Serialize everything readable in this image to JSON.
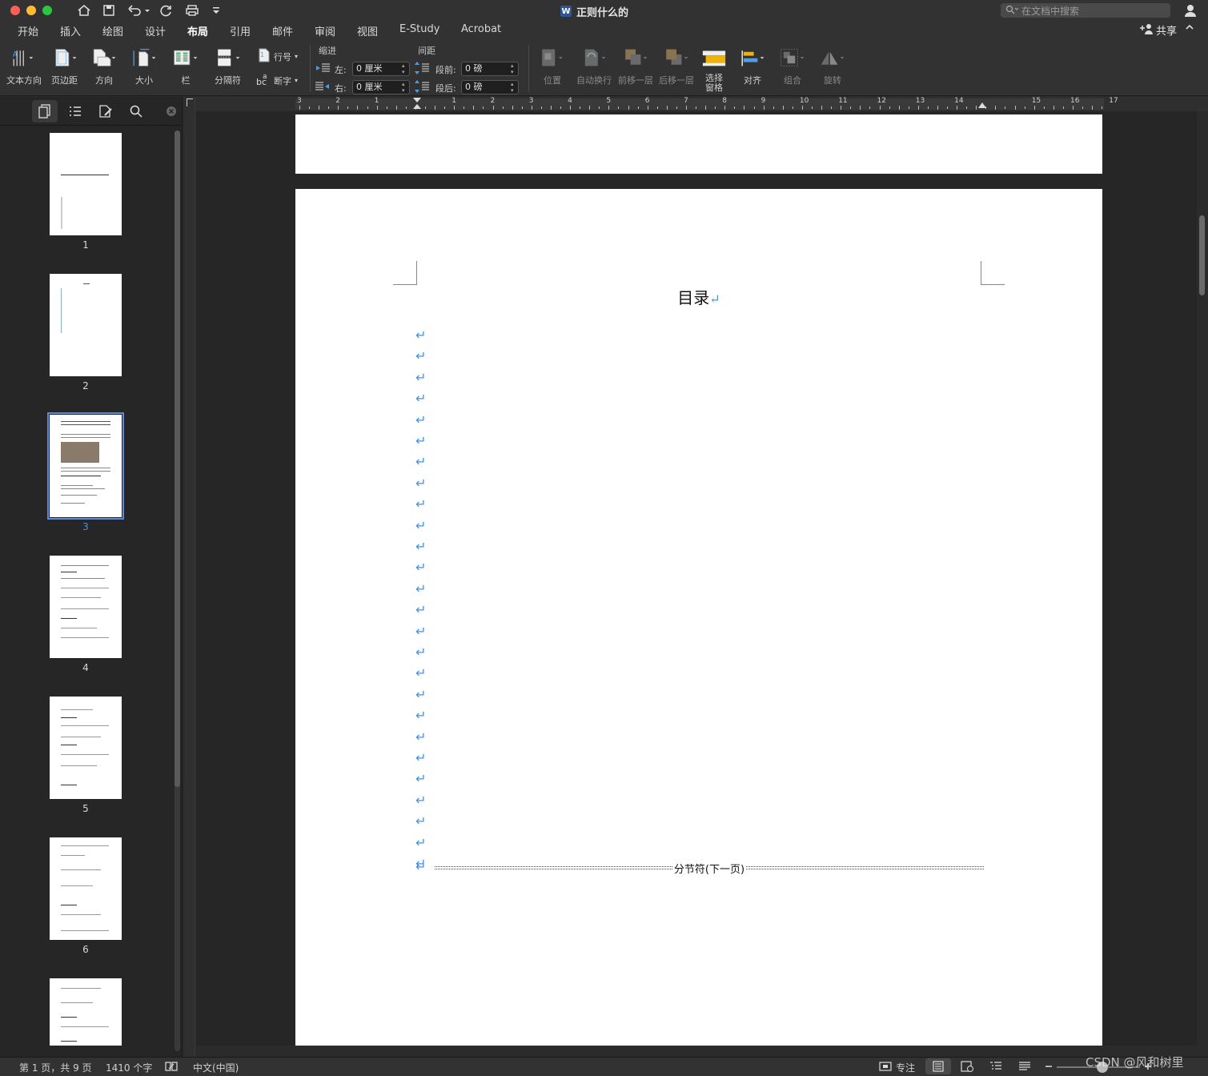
{
  "titlebar": {
    "doc_title": "正则什么的",
    "search_placeholder": "在文档中搜索"
  },
  "menu": {
    "tabs": [
      "开始",
      "插入",
      "绘图",
      "设计",
      "布局",
      "引用",
      "邮件",
      "审阅",
      "视图",
      "E-Study",
      "Acrobat"
    ],
    "active_tab": "布局",
    "share_label": "共享"
  },
  "ribbon": {
    "text_direction": "文本方向",
    "margins": "页边距",
    "orientation": "方向",
    "size": "大小",
    "columns": "栏",
    "breaks": "分隔符",
    "line_numbers": "行号",
    "hyphenation": "断字",
    "indent_label": "缩进",
    "indent_left_label": "左:",
    "indent_left_value": "0 厘米",
    "indent_right_label": "右:",
    "indent_right_value": "0 厘米",
    "spacing_label": "间距",
    "spacing_before_label": "段前:",
    "spacing_before_value": "0 磅",
    "spacing_after_label": "段后:",
    "spacing_after_value": "0 磅",
    "position": "位置",
    "wrap_text": "自动换行",
    "bring_forward": "前移一层",
    "send_backward": "后移一层",
    "selection_pane_1": "选择",
    "selection_pane_2": "窗格",
    "align": "对齐",
    "group": "组合",
    "rotate": "旋转"
  },
  "ruler": {
    "numbers": [
      "3",
      "2",
      "1",
      "",
      "1",
      "2",
      "3",
      "4",
      "5",
      "6",
      "7",
      "8",
      "9",
      "10",
      "11",
      "12",
      "13",
      "14",
      "",
      "15",
      "16",
      "17"
    ]
  },
  "thumbnails": {
    "pages": [
      "1",
      "2",
      "3",
      "4",
      "5",
      "6"
    ],
    "selected": "3"
  },
  "document": {
    "toc_title": "目录",
    "paragraph_mark": "↵",
    "section_break_label": "分节符(下一页)"
  },
  "status": {
    "page_info": "第 1 页，共 9 页",
    "word_count": "1410 个字",
    "language": "中文(中国)",
    "focus": "专注"
  },
  "watermark": "CSDN @风和树里"
}
